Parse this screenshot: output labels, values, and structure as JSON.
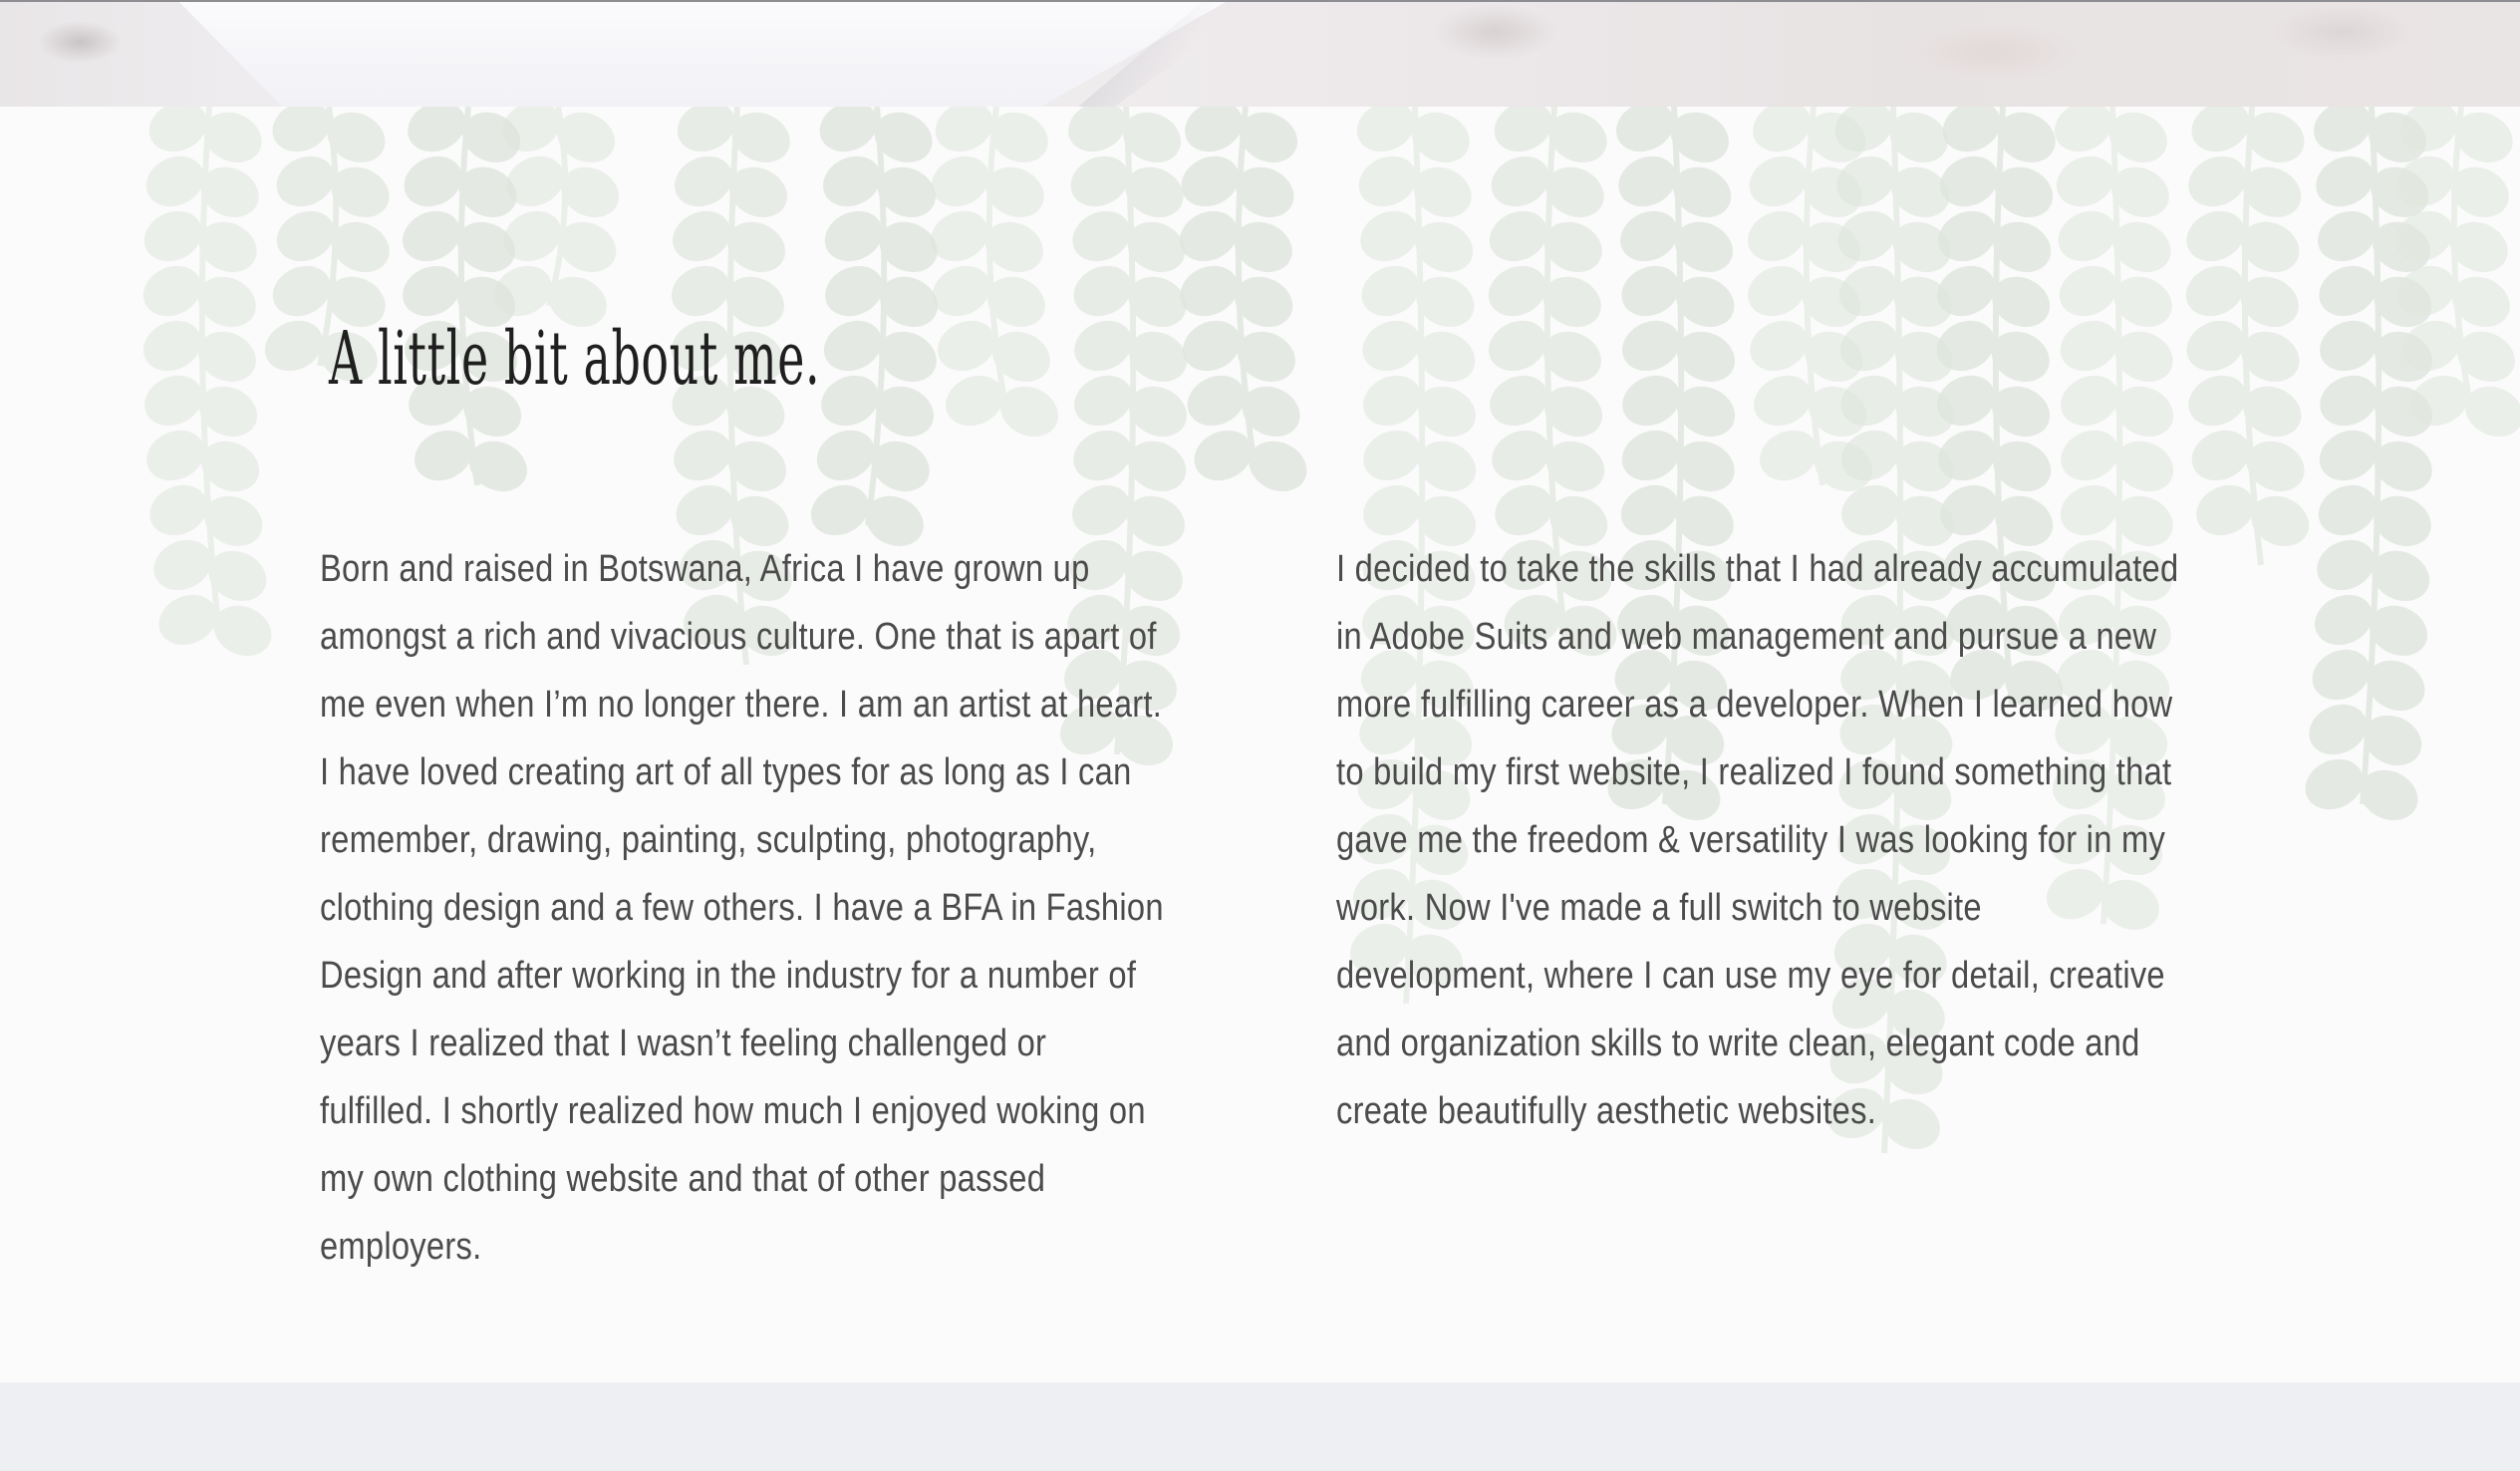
{
  "about": {
    "heading": "A little bit about me.",
    "paragraph_left": "Born and raised in Botswana, Africa I have grown up amongst a rich and vivacious culture. One that is apart of me even when I’m no longer there. I am an artist at heart. I have loved creating art of all types for as long as I can remember, drawing, painting, sculpting, photography, clothing design and a few others. I have a BFA in Fashion Design and after working in the industry for a number of years I realized that I wasn’t feeling challenged or fulfilled. I shortly realized how much I enjoyed woking on my own clothing website and that of other passed employers.",
    "paragraph_right": "I decided to take the skills that I had already accumulated in Adobe Suits and web management and pursue a new more fulfilling career as a developer. When I learned how to build my first website, I realized I found something that gave me the freedom & versatility I was looking for in my work. Now I've made a full switch to website development, where I can use my eye for detail, creative and organization skills to write clean, elegant code and create beautifully aesthetic websites."
  },
  "colors": {
    "section_background": "#fbfbfb",
    "heading_text": "#1f1f1f",
    "body_text": "#4b4b4b",
    "vine_leaf": "#dfe6dd",
    "footer_band": "#eeeff3"
  },
  "decoration": {
    "top_banner": "marble-photo-strip",
    "background": "hanging-eucalyptus-vines"
  }
}
